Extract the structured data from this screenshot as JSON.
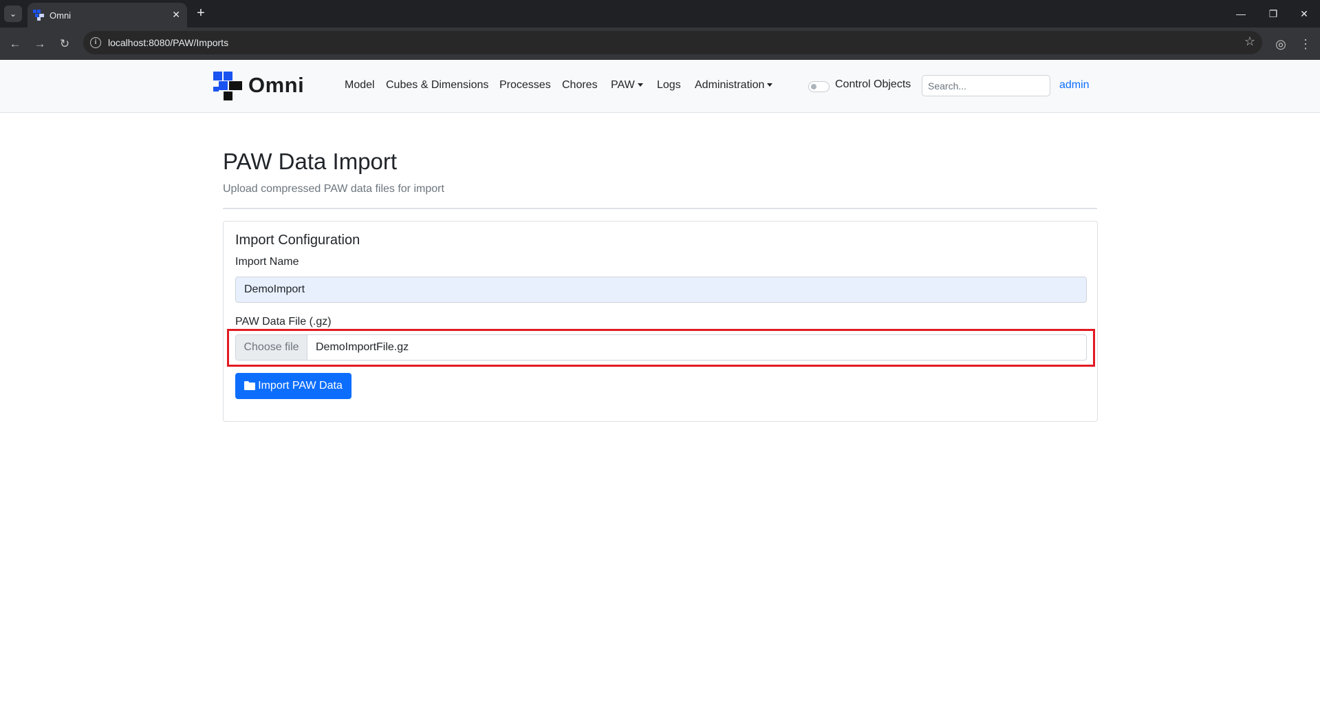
{
  "browser": {
    "tab_title": "Omni",
    "url": "localhost:8080/PAW/Imports"
  },
  "navbar": {
    "brand": "Omni",
    "items": [
      {
        "label": "Model"
      },
      {
        "label": "Cubes & Dimensions"
      },
      {
        "label": "Processes"
      },
      {
        "label": "Chores"
      },
      {
        "label": "PAW",
        "dropdown": true
      },
      {
        "label": "Logs"
      },
      {
        "label": "Administration",
        "dropdown": true
      }
    ],
    "toggle_label": "Control Objects",
    "toggle_on": false,
    "search_placeholder": "Search...",
    "user": "admin"
  },
  "page": {
    "title": "PAW Data Import",
    "subtitle": "Upload compressed PAW data files for import"
  },
  "card": {
    "title": "Import Configuration",
    "import_name_label": "Import Name",
    "import_name_value": "DemoImport",
    "file_label": "PAW Data File (.gz)",
    "file_button": "Choose file",
    "file_name": "DemoImportFile.gz",
    "submit_label": "Import PAW Data"
  },
  "colors": {
    "primary": "#0d6efd",
    "highlight": "#e21a22",
    "logo_blue": "#1a53f0",
    "logo_dark": "#111111"
  }
}
